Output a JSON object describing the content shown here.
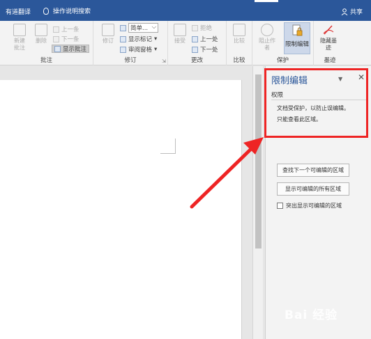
{
  "topbar": {
    "left_label": "有道翻译",
    "tell_me": "操作说明搜索",
    "share": "共享"
  },
  "ribbon": {
    "groups": {
      "comments": "批注",
      "tracking": "修订",
      "changes": "更改",
      "compare": "比较",
      "protect": "保护",
      "ink": "墨迹"
    },
    "comments": {
      "new": "新建\n批注",
      "delete": "删除",
      "prev": "上一条",
      "next": "下一条",
      "show": "显示批注"
    },
    "tracking": {
      "track": "修订",
      "markup_value": "简单...",
      "show_markup": "显示标记",
      "review_pane": "审阅窗格"
    },
    "changes": {
      "accept": "接受",
      "reject": "拒绝",
      "prev": "上一处",
      "next": "下一处"
    },
    "compare": {
      "compare": "比较"
    },
    "protect": {
      "block_authors": "阻止作者",
      "restrict": "限制编辑"
    },
    "ink": {
      "hide_ink": "隐藏墨\n迹"
    }
  },
  "pane": {
    "title": "限制编辑",
    "subtitle": "权限",
    "message_line1": "文档受保护，以防止误编辑。",
    "message_line2": "只能查看此区域。",
    "btn_find_next": "查找下一个可编辑的区域",
    "btn_show_all": "显示可编辑的所有区域",
    "chk_highlight": "突出显示可编辑的区域"
  },
  "watermark": "Bai 经验",
  "colors": {
    "titlebar": "#2b579a",
    "highlight_box": "#ee2424",
    "pane_title": "#2b579a"
  }
}
